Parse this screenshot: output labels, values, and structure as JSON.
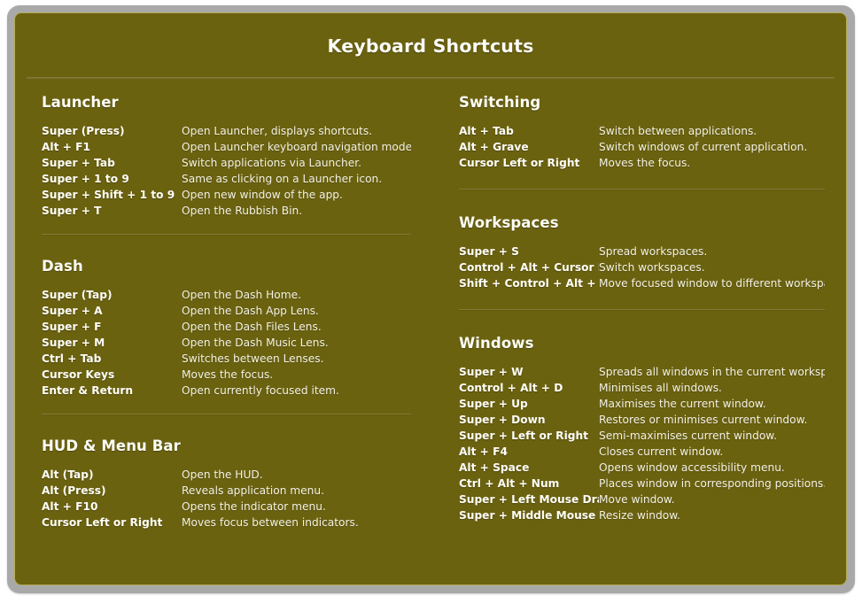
{
  "window": {
    "title": "Keyboard Shortcuts",
    "frame_color": "#a9a9a9",
    "card_background": "#6b6210",
    "card_border": "#b4ab55",
    "text_color": "#fdfdf7"
  },
  "columns": {
    "left": [
      {
        "title": "Launcher",
        "shortcuts": [
          {
            "keys": "Super (Press)",
            "description": "Open Launcher, displays shortcuts."
          },
          {
            "keys": "Alt + F1",
            "description": "Open Launcher keyboard navigation mode."
          },
          {
            "keys": "Super + Tab",
            "description": "Switch applications via Launcher."
          },
          {
            "keys": "Super + 1 to 9",
            "description": "Same as clicking on a Launcher icon."
          },
          {
            "keys": "Super + Shift + 1 to 9",
            "description": "Open new window of the app."
          },
          {
            "keys": "Super + T",
            "description": "Open the Rubbish Bin."
          }
        ]
      },
      {
        "title": "Dash",
        "shortcuts": [
          {
            "keys": "Super (Tap)",
            "description": "Open the Dash Home."
          },
          {
            "keys": "Super + A",
            "description": "Open the Dash App Lens."
          },
          {
            "keys": "Super + F",
            "description": "Open the Dash Files Lens."
          },
          {
            "keys": "Super + M",
            "description": "Open the Dash Music Lens."
          },
          {
            "keys": "Ctrl + Tab",
            "description": "Switches between Lenses."
          },
          {
            "keys": "Cursor Keys",
            "description": "Moves the focus."
          },
          {
            "keys": "Enter & Return",
            "description": "Open currently focused item."
          }
        ]
      },
      {
        "title": "HUD & Menu Bar",
        "shortcuts": [
          {
            "keys": "Alt (Tap)",
            "description": "Open the HUD."
          },
          {
            "keys": "Alt (Press)",
            "description": "Reveals application menu."
          },
          {
            "keys": "Alt + F10",
            "description": "Opens the indicator menu."
          },
          {
            "keys": "Cursor Left or Right",
            "description": "Moves focus between indicators."
          }
        ]
      }
    ],
    "right": [
      {
        "title": "Switching",
        "shortcuts": [
          {
            "keys": "Alt + Tab",
            "description": "Switch between applications."
          },
          {
            "keys": "Alt + Grave",
            "description": "Switch windows of current application."
          },
          {
            "keys": "Cursor Left or Right",
            "description": "Moves the focus."
          }
        ]
      },
      {
        "title": "Workspaces",
        "shortcuts": [
          {
            "keys": "Super + S",
            "description": "Spread workspaces."
          },
          {
            "keys": "Control + Alt + Cursor K…",
            "description": "Switch workspaces."
          },
          {
            "keys": "Shift + Control + Alt + C…",
            "description": "Move focused window to different workspace."
          }
        ]
      },
      {
        "title": "Windows",
        "shortcuts": [
          {
            "keys": "Super + W",
            "description": "Spreads all windows in the current workspace."
          },
          {
            "keys": "Control + Alt + D",
            "description": "Minimises all windows."
          },
          {
            "keys": "Super + Up",
            "description": "Maximises the current window."
          },
          {
            "keys": "Super + Down",
            "description": "Restores or minimises current window."
          },
          {
            "keys": "Super + Left or Right",
            "description": "Semi-maximises current window."
          },
          {
            "keys": "Alt + F4",
            "description": "Closes current window."
          },
          {
            "keys": "Alt + Space",
            "description": "Opens window accessibility menu."
          },
          {
            "keys": "Ctrl + Alt + Num",
            "description": "Places window in corresponding positions."
          },
          {
            "keys": "Super + Left Mouse Drag",
            "description": "Move window."
          },
          {
            "keys": "Super + Middle Mouse D…",
            "description": "Resize window."
          }
        ]
      }
    ]
  }
}
